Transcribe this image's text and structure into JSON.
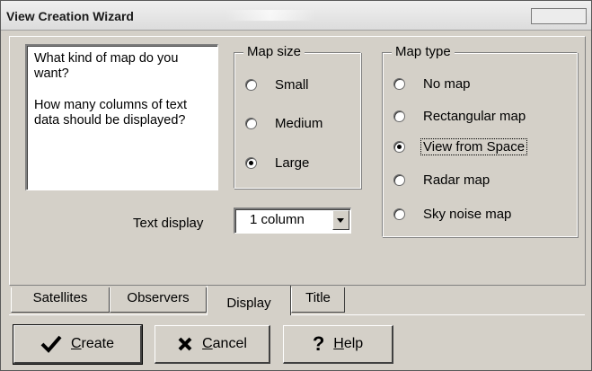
{
  "window": {
    "title": "View Creation Wizard"
  },
  "help": {
    "line1": "What kind of map do you want?",
    "line2": "How many columns of text data should be displayed?"
  },
  "map_size": {
    "legend": "Map size",
    "options": [
      {
        "label": "Small",
        "selected": false
      },
      {
        "label": "Medium",
        "selected": false
      },
      {
        "label": "Large",
        "selected": true
      }
    ]
  },
  "map_type": {
    "legend": "Map type",
    "options": [
      {
        "label": "No map",
        "selected": false
      },
      {
        "label": "Rectangular map",
        "selected": false
      },
      {
        "label": "View from Space",
        "selected": true
      },
      {
        "label": "Radar map",
        "selected": false
      },
      {
        "label": "Sky noise map",
        "selected": false
      }
    ]
  },
  "text_display": {
    "label": "Text display",
    "value": "1 column"
  },
  "tabs": [
    {
      "label": "Satellites",
      "active": false
    },
    {
      "label": "Observers",
      "active": false
    },
    {
      "label": "Display",
      "active": true
    },
    {
      "label": "Title",
      "active": false
    }
  ],
  "buttons": {
    "create": {
      "accel": "C",
      "rest": "reate",
      "icon": "checkmark-icon"
    },
    "cancel": {
      "accel": "C",
      "rest": "ancel",
      "icon": "x-icon"
    },
    "help": {
      "accel": "H",
      "rest": "elp",
      "icon": "question-icon"
    }
  }
}
